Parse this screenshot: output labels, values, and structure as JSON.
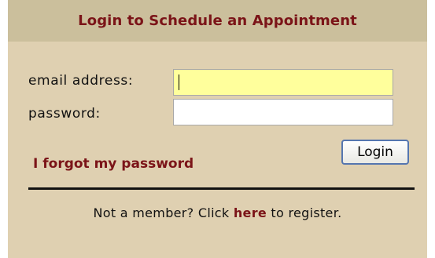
{
  "header": {
    "title": "Login to Schedule an Appointment"
  },
  "form": {
    "email_label": "email address:",
    "email_value": "",
    "password_label": "password:",
    "password_value": "",
    "login_label": "Login",
    "forgot_label": "I forgot my password"
  },
  "footer": {
    "prefix": "Not a member? Click ",
    "link_label": "here",
    "suffix": " to register."
  },
  "colors": {
    "panel_bg": "#dfd0b1",
    "header_bg": "#cbbf9c",
    "brand_text": "#7b1418",
    "focused_input_bg": "#ffff9c",
    "button_border": "#5576b0"
  }
}
